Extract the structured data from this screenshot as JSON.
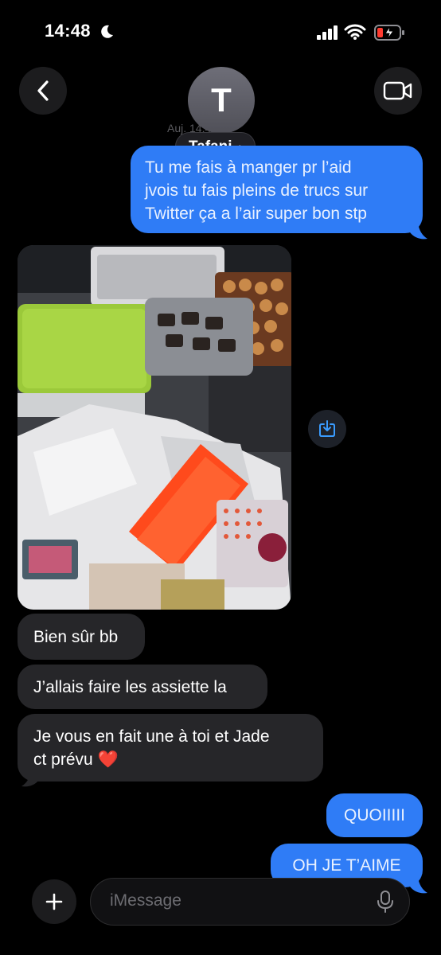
{
  "status_bar": {
    "time": "14:48"
  },
  "header": {
    "contact_initial": "T",
    "contact_name": "Tafani",
    "timestamp": "Auj. 14:46"
  },
  "messages": [
    {
      "direction": "sent",
      "text_lines": [
        "Tu me fais à manger pr l’aid",
        "jvois tu fais pleins de trucs sur",
        "Twitter ça a l’air super bon stp"
      ]
    },
    {
      "direction": "received",
      "type": "photo"
    },
    {
      "direction": "received",
      "text": "Bien sûr bb"
    },
    {
      "direction": "received",
      "text": "J’allais faire les assiette la"
    },
    {
      "direction": "received",
      "text_lines": [
        "Je vous en fait une à toi et Jade",
        "ct prévu ❤️"
      ]
    },
    {
      "direction": "sent",
      "text": "QUOIIIII"
    },
    {
      "direction": "sent",
      "text": "OH JE T’AIME"
    }
  ],
  "input": {
    "placeholder": "iMessage"
  },
  "colors": {
    "sent_bubble": "#2f7cf6",
    "received_bubble": "#262629",
    "background": "#000000"
  },
  "icons": [
    "moon-icon",
    "signal-icon",
    "wifi-icon",
    "battery-charging-icon",
    "chevron-left-icon",
    "video-camera-icon",
    "save-to-photos-icon",
    "plus-icon",
    "microphone-icon"
  ]
}
